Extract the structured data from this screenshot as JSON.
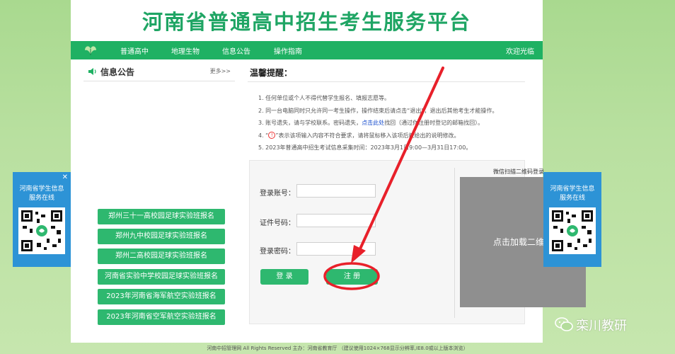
{
  "header": {
    "site_title": "河南省普通高中招生考生服务平台"
  },
  "nav": {
    "items": [
      "普通高中",
      "地理生物",
      "信息公告",
      "操作指南"
    ],
    "welcome": "欢迎光临"
  },
  "news": {
    "title": "信息公告",
    "more": "更多>>"
  },
  "side_buttons": [
    "郑州三十一高校园足球实验班报名",
    "郑州九中校园足球实验班报名",
    "郑州二高校园足球实验班报名",
    "河南省实验中学校园足球实验班报名",
    "2023年河南省海军航空实验班报名",
    "2023年河南省空军航空实验班报名"
  ],
  "tips": {
    "title": "温馨提醒：",
    "line1": "1. 任何单位或个人不得代替学生报名、填报志愿等。",
    "line2": "2. 同一台电脑同时只允许同一考生操作，操作结束后请点击“退出”，退出后其他考生才能操作。",
    "line3_a": "3. 账号遗失，请与学校联系。密码遗失，",
    "line3_link": "点击此处",
    "line3_b": "找回（通过你注册时登记的邮箱找回）。",
    "line4_a": "4. “",
    "line4_icon": "!",
    "line4_b": "”表示该项输入内容不符合要求，请将鼠标移入该项后按给出的说明修改。",
    "line5": "5. 2023年普通高中招生考试信息采集时间：2023年3月1日9:00—3月31日17:00。"
  },
  "login": {
    "account_label": "登录账号：",
    "id_label": "证件号码：",
    "password_label": "登录密码：",
    "login_button": "登 录",
    "register_button": "注 册",
    "qr_title": "微信扫描二维码登录",
    "qr_placeholder": "点击加载二维码"
  },
  "float_left": {
    "close": "✕",
    "line1": "河南省学生信息",
    "line2": "服务在线"
  },
  "float_right": {
    "line1": "河南省学生信息",
    "line2": "服务在线"
  },
  "footer": {
    "text": "河南中招管理网 All Rights Reserved 主办：河南省教育厅 （建议使用1024×768显示分辨率,IE8.0或以上版本浏览）"
  },
  "watermark": {
    "text": "栾川教研"
  },
  "colors": {
    "brand_green": "#1fb163",
    "float_blue": "#2d93d6",
    "annotation_red": "#e8202a"
  }
}
